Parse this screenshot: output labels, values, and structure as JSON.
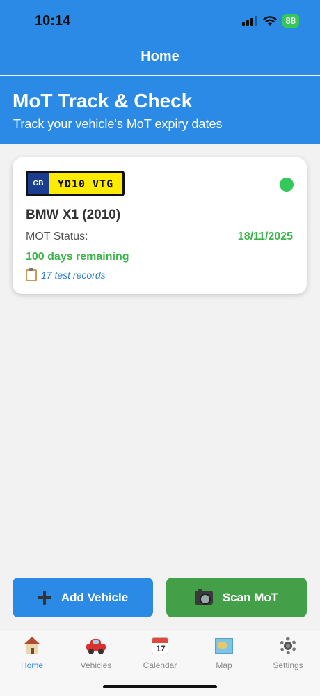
{
  "status_bar": {
    "time": "10:14",
    "battery": "88"
  },
  "nav": {
    "title": "Home"
  },
  "hero": {
    "title": "MoT Track & Check",
    "subtitle": "Track your vehicle's MoT expiry dates"
  },
  "vehicle_card": {
    "plate_country": "GB",
    "plate_reg": "YD10 VTG",
    "status_color": "#34c759",
    "name": "BMW X1 (2010)",
    "mot_label": "MOT Status:",
    "mot_date": "18/11/2025",
    "days_remaining": "100 days remaining",
    "records": "17 test records"
  },
  "actions": {
    "add_vehicle": "Add Vehicle",
    "scan_mot": "Scan MoT"
  },
  "tabs": [
    {
      "label": "Home",
      "icon": "house-icon",
      "active": true
    },
    {
      "label": "Vehicles",
      "icon": "car-icon",
      "active": false
    },
    {
      "label": "Calendar",
      "icon": "calendar-icon",
      "active": false,
      "icon_text": "17"
    },
    {
      "label": "Map",
      "icon": "map-icon",
      "active": false
    },
    {
      "label": "Settings",
      "icon": "gear-icon",
      "active": false
    }
  ],
  "colors": {
    "primary": "#2a8ae6",
    "success": "#3cb54a",
    "scan_button": "#43a048"
  }
}
